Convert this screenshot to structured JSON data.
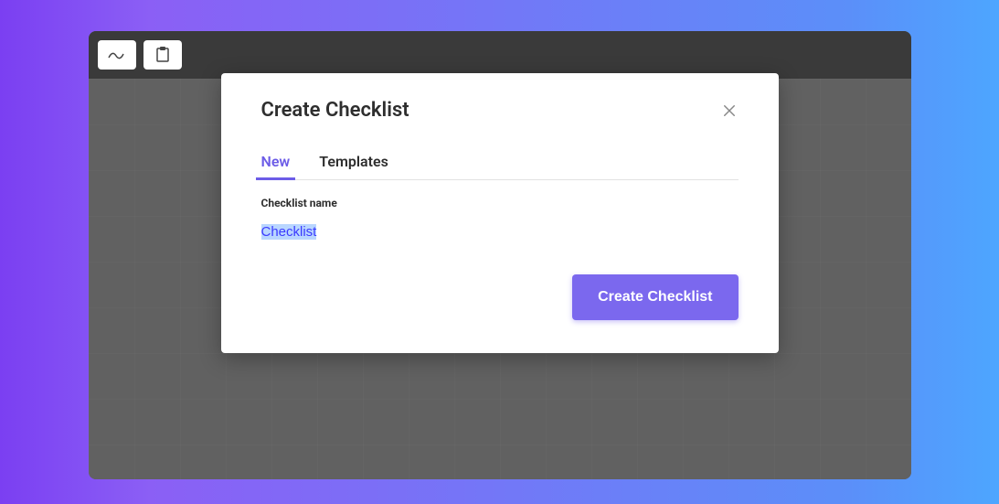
{
  "modal": {
    "title": "Create Checklist",
    "tabs": {
      "new": "New",
      "templates": "Templates"
    },
    "field_label": "Checklist name",
    "input_value": "Checklist",
    "submit_label": "Create Checklist"
  }
}
